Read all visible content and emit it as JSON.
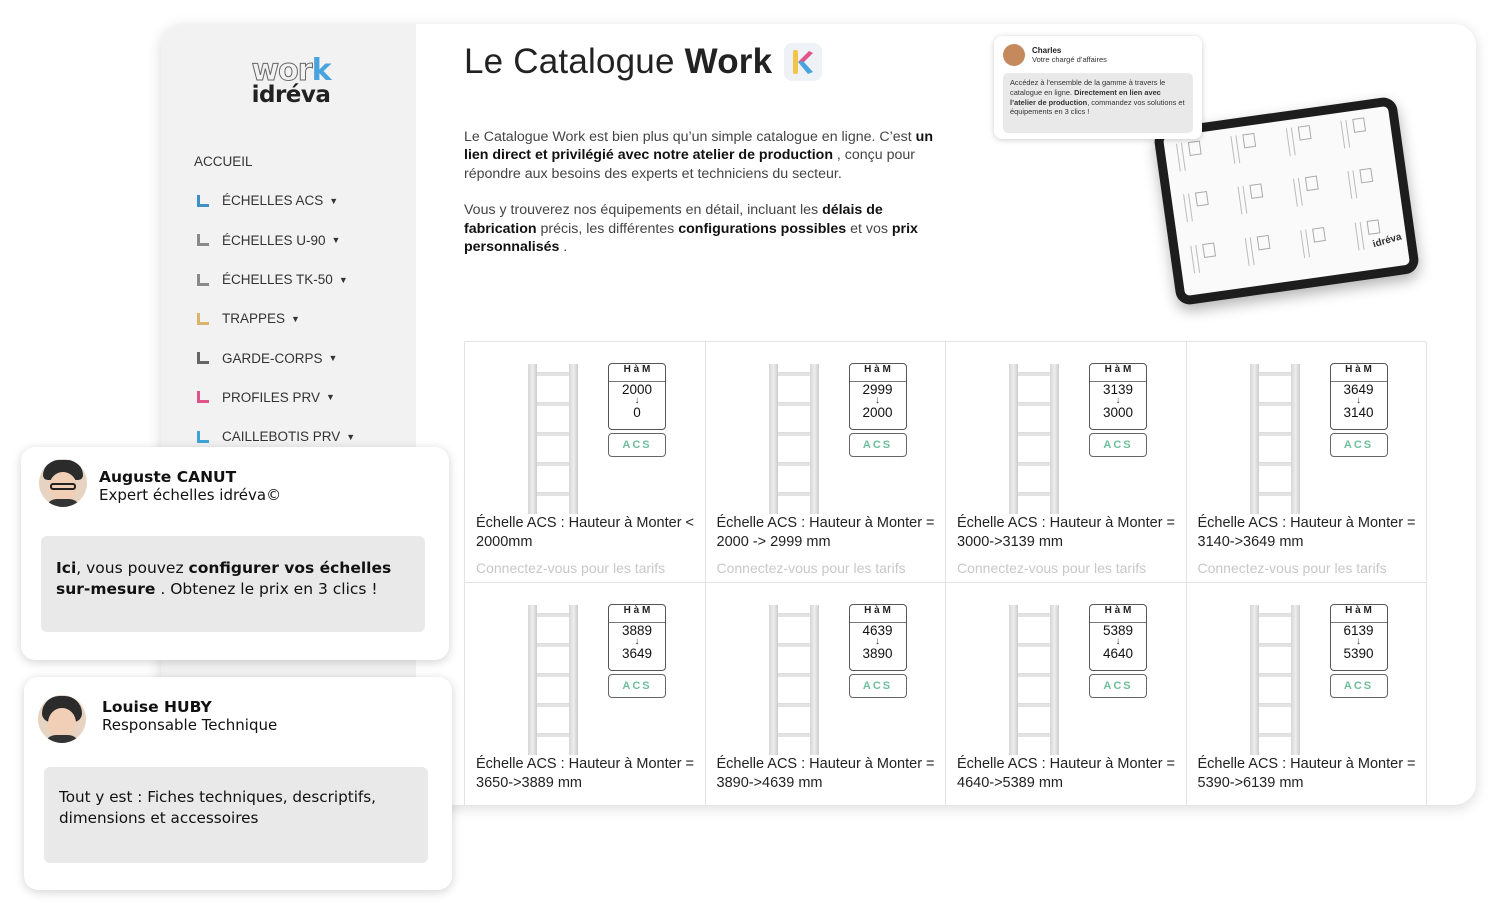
{
  "logo": {
    "work": "wor",
    "k": "k",
    "brand": "idréva"
  },
  "nav": {
    "home": "ACCUEIL",
    "items": [
      {
        "label": "ÉCHELLES ACS",
        "icon": "drop-icon",
        "color": "#3d8fc6"
      },
      {
        "label": "ÉCHELLES U-90",
        "icon": "ladder-icon",
        "color": "#8a8a8a"
      },
      {
        "label": "ÉCHELLES TK-50",
        "icon": "ladder-icon",
        "color": "#8a8a8a"
      },
      {
        "label": "TRAPPES",
        "icon": "hatch-icon",
        "color": "#d9b46a"
      },
      {
        "label": "GARDE-CORPS",
        "icon": "guardrail-icon",
        "color": "#666666"
      },
      {
        "label": "PROFILES PRV",
        "icon": "profile-icon",
        "color": "#e0548c"
      },
      {
        "label": "CAILLEBOTIS PRV",
        "icon": "grating-icon",
        "color": "#3fa3d8"
      }
    ]
  },
  "header": {
    "title_light": "Le Catalogue",
    "title_bold": "Work"
  },
  "intro": {
    "p1_a": "Le Catalogue Work est bien plus qu’un simple catalogue en ligne. C’est ",
    "p1_b": "un lien direct et privilégié avec notre atelier de production",
    "p1_c": " , conçu pour répondre aux besoins des experts et techniciens du secteur.",
    "p2_a": "Vous y trouverez nos équipements en détail, incluant les ",
    "p2_b": "délais de fabrication",
    "p2_c": " précis, les différentes ",
    "p2_d": "configurations possibles",
    "p2_e": " et vos ",
    "p2_f": "prix personnalisés",
    "p2_g": " ."
  },
  "mini_chat": {
    "name": "Charles",
    "role": "Votre chargé d’affaires",
    "msg_a": "Accédez à l’ensemble de la gamme à travers le catalogue en ligne. ",
    "msg_b": "Directement en lien avec l’atelier de production",
    "msg_c": ", commandez vos solutions et équipements en 3 clics !"
  },
  "tablet": {
    "brand": "idréva"
  },
  "products": [
    {
      "top": "2000",
      "bottom": "0",
      "title": "Échelle ACS : Hauteur à Monter < 2000mm",
      "price": "Connectez-vous pour les tarifs"
    },
    {
      "top": "2999",
      "bottom": "2000",
      "title": "Échelle ACS : Hauteur à Monter = 2000 -> 2999 mm",
      "price": "Connectez-vous pour les tarifs"
    },
    {
      "top": "3139",
      "bottom": "3000",
      "title": "Échelle ACS : Hauteur à Monter = 3000->3139 mm",
      "price": "Connectez-vous pour les tarifs"
    },
    {
      "top": "3649",
      "bottom": "3140",
      "title": "Échelle ACS : Hauteur à Monter = 3140->3649 mm",
      "price": "Connectez-vous pour les tarifs"
    },
    {
      "top": "3889",
      "bottom": "3649",
      "title": "Échelle ACS : Hauteur à Monter = 3650->3889 mm",
      "price": ""
    },
    {
      "top": "4639",
      "bottom": "3890",
      "title": "Échelle ACS : Hauteur à Monter = 3890->4639 mm",
      "price": ""
    },
    {
      "top": "5389",
      "bottom": "4640",
      "title": "Échelle ACS : Hauteur à Monter = 4640->5389 mm",
      "price": ""
    },
    {
      "top": "6139",
      "bottom": "5390",
      "title": "Échelle ACS : Hauteur à Monter = 5390->6139 mm",
      "price": ""
    }
  ],
  "product_badge": {
    "ham": "H à M",
    "acs": "ACS"
  },
  "expert1": {
    "name": "Auguste CANUT",
    "role": "Expert échelles idréva©",
    "msg_a": "Ici",
    "msg_b": ", vous pouvez ",
    "msg_c": "configurer vos échelles sur-mesure",
    "msg_d": " . Obtenez le prix en 3 clics !"
  },
  "expert2": {
    "name": "Louise HUBY",
    "role": "Responsable Technique",
    "msg": "Tout y est : Fiches techniques, descriptifs, dimensions et accessoires"
  }
}
